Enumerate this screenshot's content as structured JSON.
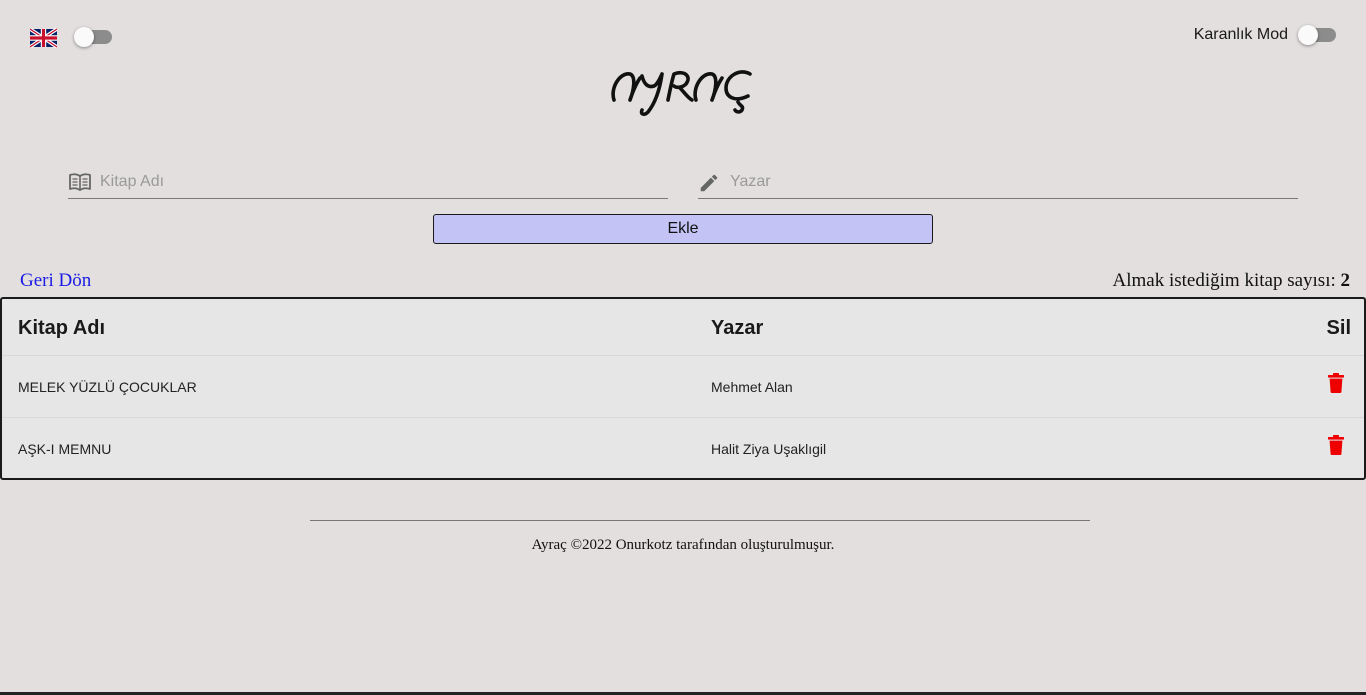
{
  "header": {
    "language_flag_icon": "uk-flag-icon",
    "dark_mode_label": "Karanlık Mod",
    "logo_text": "AYRAÇ"
  },
  "form": {
    "book_placeholder": "Kitap Adı",
    "author_placeholder": "Yazar",
    "book_icon": "book-open-icon",
    "author_icon": "pencil-icon",
    "add_label": "Ekle"
  },
  "nav": {
    "back_label": "Geri Dön",
    "count_label": "Almak istediğim kitap sayısı:",
    "count_value": "2"
  },
  "table": {
    "headers": [
      "Kitap Adı",
      "Yazar",
      "Sil"
    ],
    "rows": [
      {
        "title": "MELEK YÜZLÜ ÇOCUKLAR",
        "author": "Mehmet Alan"
      },
      {
        "title": "AŞK-I MEMNU",
        "author": "Halit Ziya Uşaklıgil"
      }
    ],
    "delete_icon": "trash-icon",
    "delete_color": "#ee0000"
  },
  "footer": {
    "text": "Ayraç ©2022 Onurkotz tarafından oluşturulmuşur."
  },
  "colors": {
    "background": "#e2dfde",
    "button": "#c3c3f5",
    "link": "#1a1ae6"
  }
}
